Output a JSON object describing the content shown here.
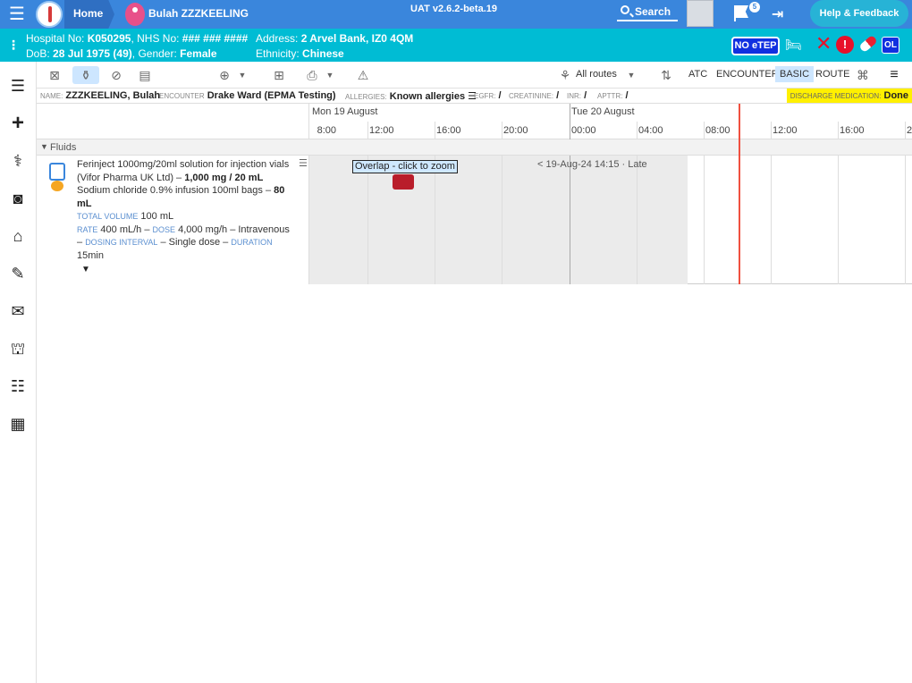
{
  "topbar": {
    "home": "Home",
    "patient_name": "Bulah ZZZKEELING",
    "version": "UAT v2.6.2-beta.19",
    "search": "Search",
    "notifications_count": "5",
    "help": "Help & Feedback"
  },
  "demographics": {
    "hospital_label": "Hospital No:",
    "hospital_no": "K050295",
    "nhs_label": "NHS No:",
    "nhs_no": "### ### ####",
    "dob_label": "DoB:",
    "dob": "28 Jul 1975 (49)",
    "gender_label": "Gender:",
    "gender": "Female",
    "address_label": "Address:",
    "address": "2 Arvel Bank, IZ0 4QM",
    "ethnicity_label": "Ethnicity:",
    "ethnicity": "Chinese",
    "no_etep": "NO eTEP",
    "ol": "OL"
  },
  "toolbar": {
    "routes": "All routes",
    "atc": "ATC",
    "encounter": "ENCOUNTER",
    "basic": "BASIC",
    "route": "ROUTE"
  },
  "info": {
    "name_label": "Name:",
    "name": "ZZZKEELING, Bulah",
    "encounter_label": "Encounter",
    "encounter": "Drake Ward (EPMA Testing)",
    "allergies_label": "Allergies:",
    "allergies": "Known allergies",
    "egfr_label": "eGFR:",
    "egfr": "/",
    "creatinine_label": "Creatinine:",
    "creatinine": "/",
    "inr_label": "INR:",
    "inr": "/",
    "aptr_label": "APTTR:",
    "aptr": "/",
    "discharge_label": "Discharge medication:",
    "discharge": "Done"
  },
  "timeline": {
    "day1": "Mon 19 August",
    "day2": "Tue 20 August",
    "hours": [
      "8:00",
      "12:00",
      "16:00",
      "20:00",
      "00:00",
      "04:00",
      "08:00",
      "12:00",
      "16:00",
      "2"
    ]
  },
  "group": {
    "label": "Fluids"
  },
  "medication": {
    "line1": "Ferinject 1000mg/20ml solution for injection vials (Vifor Pharma UK Ltd) –",
    "dose1": "1,000 mg / 20 mL",
    "line2": "Sodium chloride 0.9% infusion 100ml bags –",
    "dose2": "80 mL",
    "total_volume_label": "Total volume",
    "total_volume": "100 mL",
    "rate_label": "Rate",
    "rate": "400 mL/h –",
    "dose_label": "Dose",
    "dose": "4,000 mg/h – Intravenous –",
    "interval_label": "Dosing interval",
    "interval": "– Single dose –",
    "duration_label": "Duration",
    "duration": "15min",
    "overlap": "Overlap - click to zoom",
    "late": "< 19-Aug-24 14:15 · Late"
  }
}
